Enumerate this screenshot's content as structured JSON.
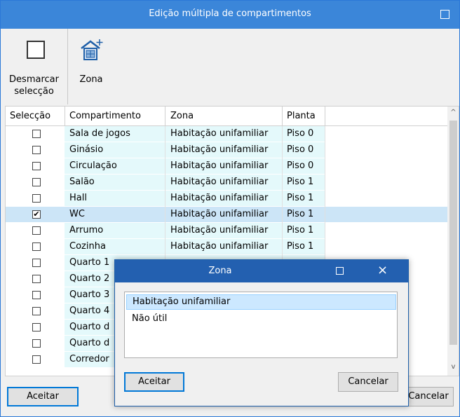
{
  "window": {
    "title": "Edição múltipla de compartimentos"
  },
  "toolbar": {
    "deselect_line1": "Desmarcar",
    "deselect_line2": "selecção",
    "zona_label": "Zona"
  },
  "table": {
    "headers": {
      "sel": "Selecção",
      "comp": "Compartimento",
      "zona": "Zona",
      "planta": "Planta"
    },
    "rows": [
      {
        "checked": false,
        "comp": "Sala de jogos",
        "zona": "Habitação unifamiliar",
        "planta": "Piso 0"
      },
      {
        "checked": false,
        "comp": "Ginásio",
        "zona": "Habitação unifamiliar",
        "planta": "Piso 0"
      },
      {
        "checked": false,
        "comp": "Circulação",
        "zona": "Habitação unifamiliar",
        "planta": "Piso 0"
      },
      {
        "checked": false,
        "comp": "Salão",
        "zona": "Habitação unifamiliar",
        "planta": "Piso 1"
      },
      {
        "checked": false,
        "comp": "Hall",
        "zona": "Habitação unifamiliar",
        "planta": "Piso 1"
      },
      {
        "checked": true,
        "comp": "WC",
        "zona": "Habitação unifamiliar",
        "planta": "Piso 1"
      },
      {
        "checked": false,
        "comp": "Arrumo",
        "zona": "Habitação unifamiliar",
        "planta": "Piso 1"
      },
      {
        "checked": false,
        "comp": "Cozinha",
        "zona": "Habitação unifamiliar",
        "planta": "Piso 1"
      },
      {
        "checked": false,
        "comp": "Quarto 1",
        "zona": "",
        "planta": ""
      },
      {
        "checked": false,
        "comp": "Quarto 2",
        "zona": "",
        "planta": ""
      },
      {
        "checked": false,
        "comp": "Quarto 3",
        "zona": "",
        "planta": ""
      },
      {
        "checked": false,
        "comp": "Quarto 4",
        "zona": "",
        "planta": ""
      },
      {
        "checked": false,
        "comp": "Quarto d",
        "zona": "",
        "planta": ""
      },
      {
        "checked": false,
        "comp": "Quarto d",
        "zona": "",
        "planta": ""
      },
      {
        "checked": false,
        "comp": "Corredor",
        "zona": "",
        "planta": ""
      }
    ]
  },
  "buttons": {
    "accept": "Aceitar",
    "cancel": "Cancelar"
  },
  "dialog": {
    "title": "Zona",
    "items": [
      "Habitação unifamiliar",
      "Não útil"
    ],
    "accept": "Aceitar",
    "cancel": "Cancelar"
  },
  "icons": {
    "close": "×",
    "check": "✔",
    "scroll_up": "^",
    "scroll_down": "v"
  }
}
